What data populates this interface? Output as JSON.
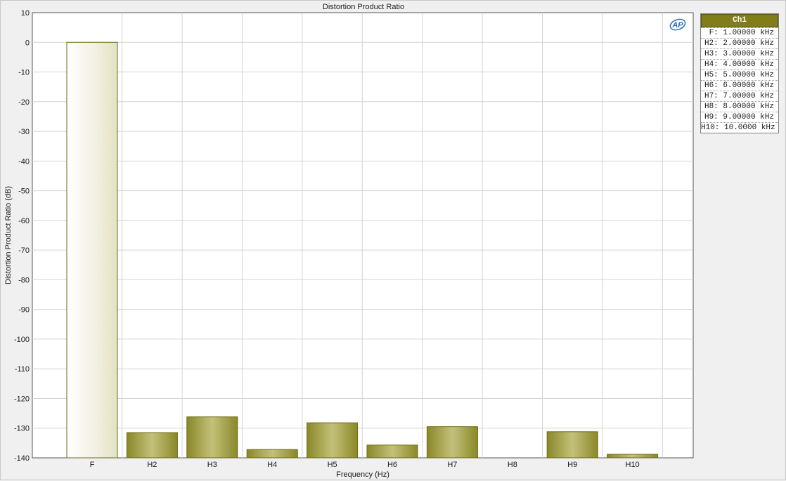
{
  "colors": {
    "bar_fill_light": "#f4f3e6",
    "bar_fill_dark": "#8c8a2a",
    "bar_stroke": "#6e6c14",
    "grid": "#d4d4d4",
    "legend_header_bg": "#807d1a",
    "logo": "#2a6bb5"
  },
  "logo_text": "AP",
  "legend": {
    "header": "Ch1",
    "items": [
      "F: 1.00000 kHz",
      "H2: 2.00000 kHz",
      "H3: 3.00000 kHz",
      "H4: 4.00000 kHz",
      "H5: 5.00000 kHz",
      "H6: 6.00000 kHz",
      "H7: 7.00000 kHz",
      "H8: 8.00000 kHz",
      "H9: 9.00000 kHz",
      "H10: 10.0000 kHz"
    ]
  },
  "chart_data": {
    "type": "bar",
    "title": "Distortion Product Ratio",
    "xlabel": "Frequency (Hz)",
    "ylabel": "Distortion Product Ratio (dB)",
    "ylim": [
      -140,
      10
    ],
    "yticks": [
      10,
      0,
      -10,
      -20,
      -30,
      -40,
      -50,
      -60,
      -70,
      -80,
      -90,
      -100,
      -110,
      -120,
      -130,
      -140
    ],
    "grid": true,
    "legend_position": "right",
    "categories": [
      "F",
      "H2",
      "H3",
      "H4",
      "H5",
      "H6",
      "H7",
      "H8",
      "H9",
      "H10"
    ],
    "series": [
      {
        "name": "Ch1",
        "values": [
          0,
          -131.5,
          -126.2,
          -137.2,
          -128.2,
          -135.7,
          -129.5,
          null,
          -131.2,
          -138.8
        ]
      }
    ]
  }
}
